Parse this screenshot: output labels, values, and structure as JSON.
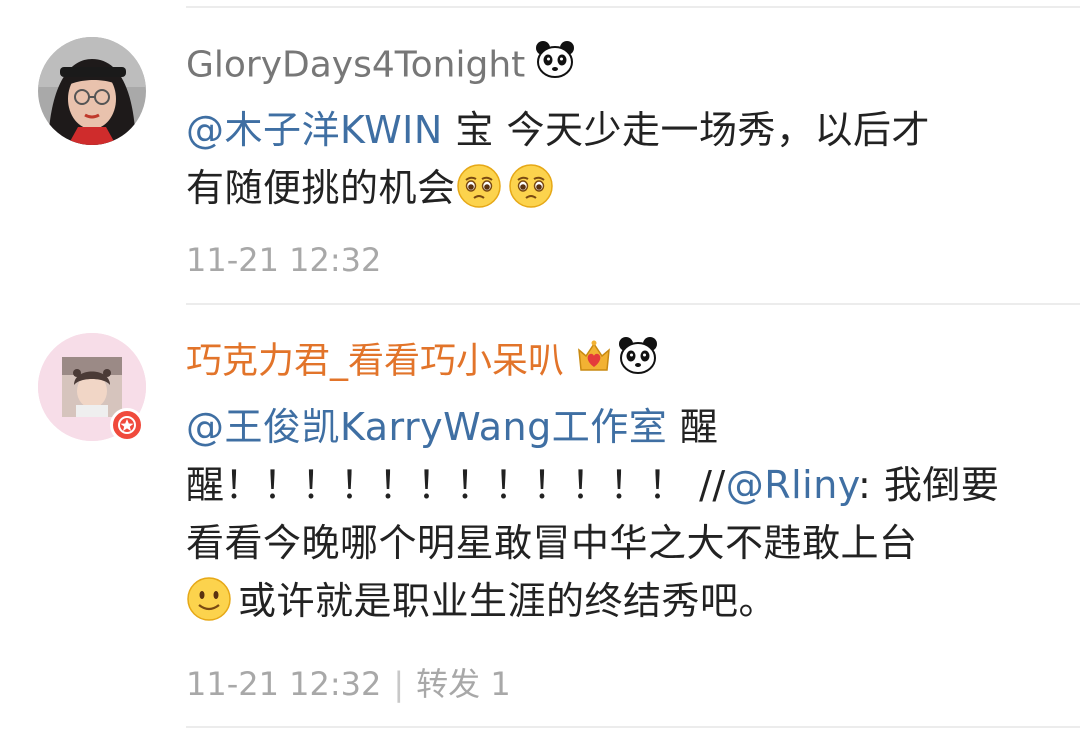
{
  "comments": [
    {
      "username": "GloryDays4Tonight",
      "username_color": "#777777",
      "icons": [
        "panda-icon"
      ],
      "line1": {
        "mention": "@木子洋KWIN",
        "text": " 宝 今天少走一场秀，以后才"
      },
      "line2": {
        "text": "有随便挑的机会",
        "emojis": [
          "pleading-face-emoji",
          "pleading-face-emoji"
        ]
      },
      "time": "11-21 12:32"
    },
    {
      "username": "巧克力君_看看巧小呆叭",
      "username_color": "#e2742a",
      "icons": [
        "crown-heart-icon",
        "panda-icon"
      ],
      "verified_badge": "red-star-badge",
      "line1": {
        "mention": "@王俊凯KarryWang工作室",
        "text": " 醒"
      },
      "line2": {
        "text": "醒！！！！！！！！！！！！ //",
        "mention": "@Rliny",
        "text_after": ": 我倒要"
      },
      "line3": {
        "text": "看看今晚哪个明星敢冒中华之大不韪敢上台"
      },
      "line4": {
        "emoji": "slight-smile-emoji",
        "text": "或许就是职业生涯的终结秀吧。"
      },
      "time": "11-21 12:32",
      "separator": "|",
      "repost_label": "转发 1"
    }
  ]
}
